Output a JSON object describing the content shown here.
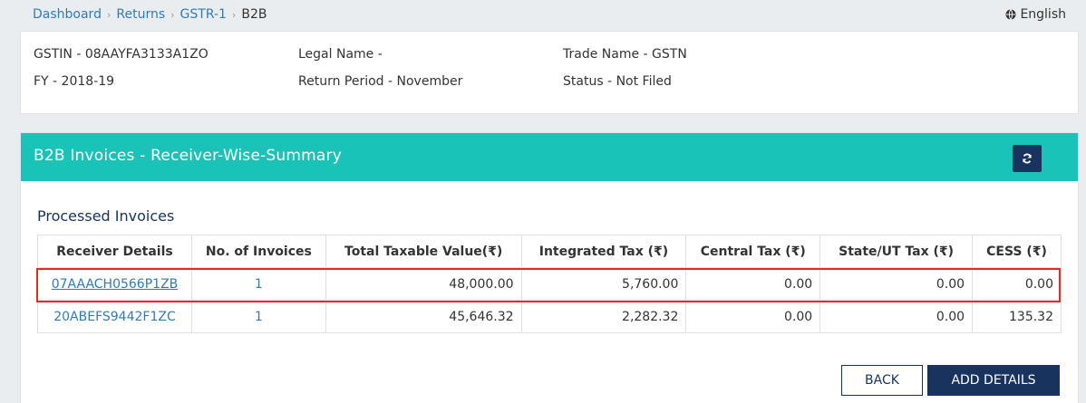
{
  "breadcrumb": {
    "items": [
      "Dashboard",
      "Returns",
      "GSTR-1"
    ],
    "current": "B2B"
  },
  "language": "English",
  "info": {
    "gstin": "GSTIN - 08AAYFA3133A1ZO",
    "legal_name": "Legal Name -",
    "trade_name": "Trade Name - GSTN",
    "fy": "FY - 2018-19",
    "return_period": "Return Period - November",
    "status": "Status - Not Filed"
  },
  "panel": {
    "title": "B2B Invoices - Receiver-Wise-Summary",
    "section_title": "Processed Invoices"
  },
  "table": {
    "headers": [
      "Receiver Details",
      "No. of Invoices",
      "Total Taxable Value(₹)",
      "Integrated Tax (₹)",
      "Central Tax (₹)",
      "State/UT Tax (₹)",
      "CESS (₹)"
    ],
    "rows": [
      [
        "07AAACH0566P1ZB",
        "1",
        "48,000.00",
        "5,760.00",
        "0.00",
        "0.00",
        "0.00"
      ],
      [
        "20ABEFS9442F1ZC",
        "1",
        "45,646.32",
        "2,282.32",
        "0.00",
        "0.00",
        "135.32"
      ]
    ]
  },
  "buttons": {
    "back": "BACK",
    "add_details": "ADD DETAILS"
  },
  "colors": {
    "header_teal": "#19c3b7",
    "navy": "#17335e",
    "link_blue": "#337ab7",
    "highlight_red": "#e12a2a"
  }
}
